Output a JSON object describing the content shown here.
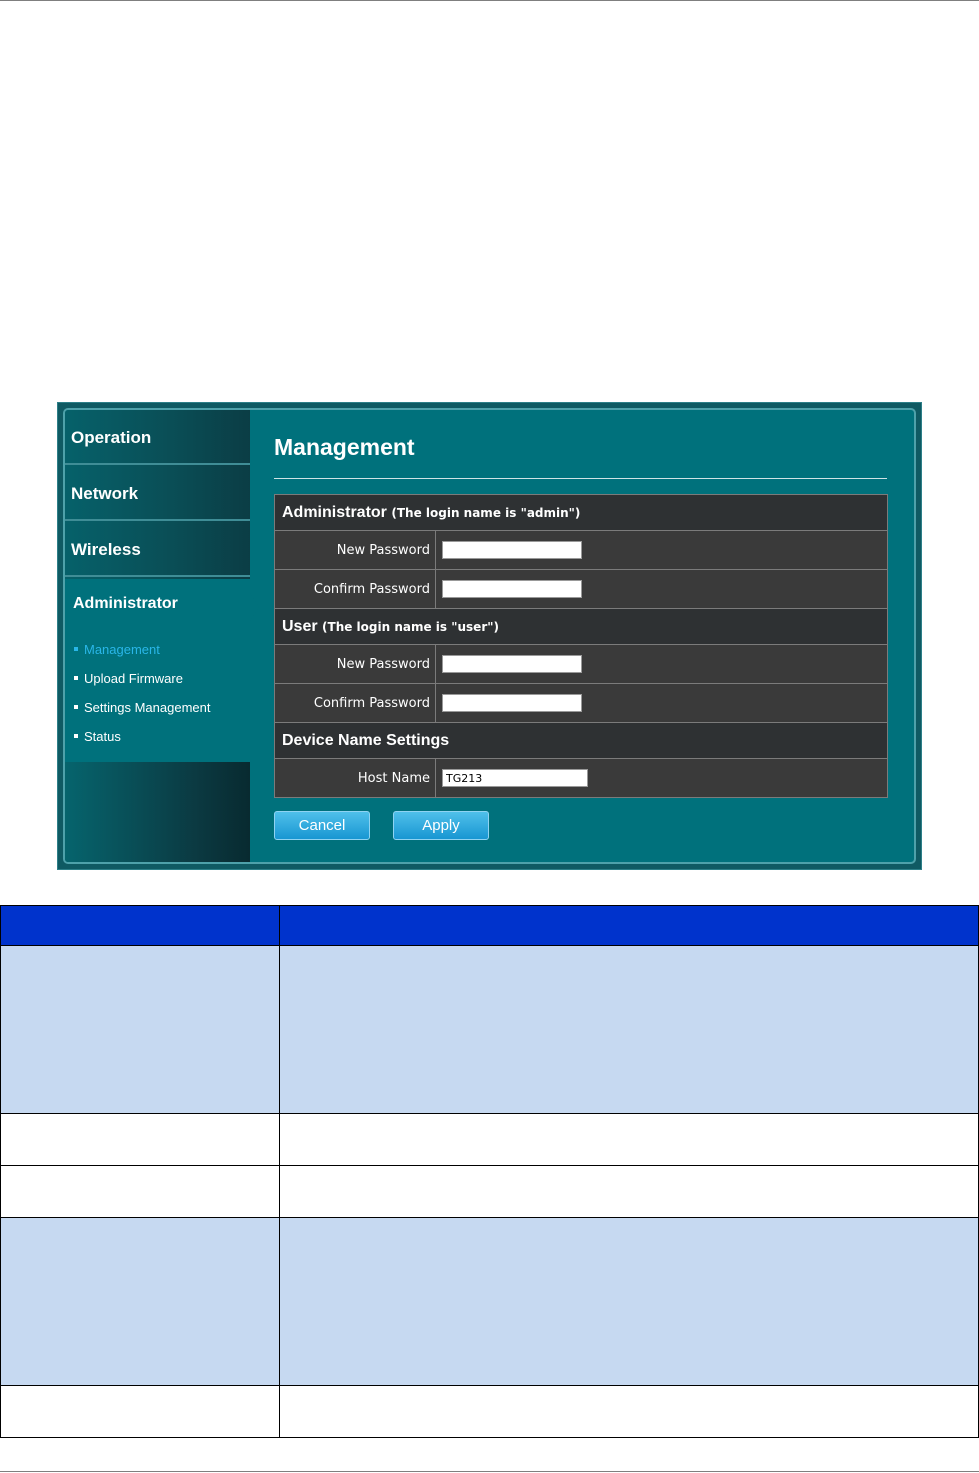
{
  "nav": {
    "items": [
      "Operation",
      "Network",
      "Wireless"
    ],
    "active": "Administrator",
    "subitems": [
      "Management",
      "Upload Firmware",
      "Settings Management",
      "Status"
    ]
  },
  "page": {
    "title": "Management"
  },
  "sections": {
    "administrator": {
      "title": "Administrator",
      "note": "(The login name is \"admin\")"
    },
    "user": {
      "title": "User",
      "note": "(The login name is \"user\")"
    },
    "device": {
      "title": "Device Name Settings"
    }
  },
  "fields": {
    "new_password": "New Password",
    "confirm_password": "Confirm Password",
    "host_name": "Host Name",
    "host_name_value": "TG213"
  },
  "buttons": {
    "cancel": "Cancel",
    "apply": "Apply"
  },
  "colors": {
    "accent": "#00717c",
    "current_link": "#29b6e8",
    "doc_header": "#0033cc",
    "doc_shade": "#c6d9f1"
  }
}
